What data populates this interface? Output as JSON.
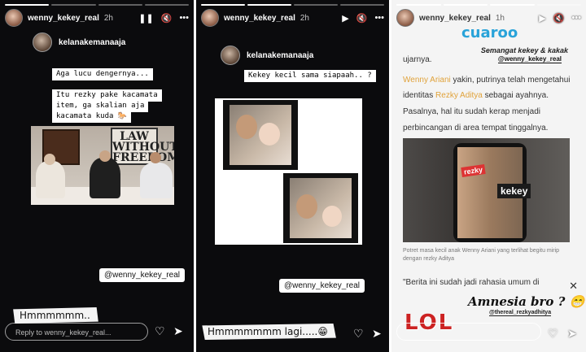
{
  "account": {
    "username": "wenny_kekey_real"
  },
  "stories": [
    {
      "time": "2h",
      "poster": "kelanakemanaaja",
      "text_lines": [
        "Aga lucu dengernya...",
        "Itu rezky pake kacamata",
        "item, ga skalian aja",
        "kacamata kuda 🐎"
      ],
      "tag": "@wenny_kekey_real",
      "sticker": "Hmmmmmm..",
      "reply_placeholder": "Reply to wenny_kekey_real...",
      "video_poster_text": "LAW WITHOUT FREEDOM",
      "icons": [
        "pause-icon",
        "mute-icon",
        "more-icon",
        "heart-icon",
        "send-icon"
      ]
    },
    {
      "time": "2h",
      "poster": "kelanakemanaaja",
      "question": "Kekey kecil sama siapaah.. ?",
      "tag": "@wenny_kekey_real",
      "sticker": "Hmmmmmmm lagi.....😁",
      "icons": [
        "play-icon",
        "mute-icon",
        "more-icon",
        "heart-icon",
        "send-icon"
      ]
    },
    {
      "time": "1h",
      "site": "cuaroo",
      "overlay_top": "Semangat kekey & kakak",
      "overlay_tag": "@wenny_kekey_real",
      "article_lines": [
        "ujarnya.",
        "Wenny Ariani yakin, putrinya telah mengetahui",
        "identitas Rezky Aditya sebagai ayahnya.",
        "Pasalnya, hal itu sudah kerap menjadi",
        "perbincangan di area tempat tinggalnya."
      ],
      "highlight_1": "Wenny Ariani",
      "highlight_2": "Rezky Aditya",
      "photo_labels": [
        "rezky",
        "kekey"
      ],
      "caption": "Potret masa kecil anak Wenny Ariani yang terlihat begitu mirip dengan rezky Aditya",
      "quote": "\"Berita ini sudah jadi rahasia umum di",
      "amnesia": "Amnesia bro ? 😁",
      "amnesia_tag": "@thereal_rezkyadhitya",
      "lol": "LOL",
      "icons": [
        "play-icon",
        "mute-icon",
        "more-icon",
        "close-icon",
        "heart-icon",
        "send-icon"
      ]
    }
  ],
  "colors": {
    "highlight": "#e0a23a",
    "story_bg": "#0b0b0d"
  }
}
